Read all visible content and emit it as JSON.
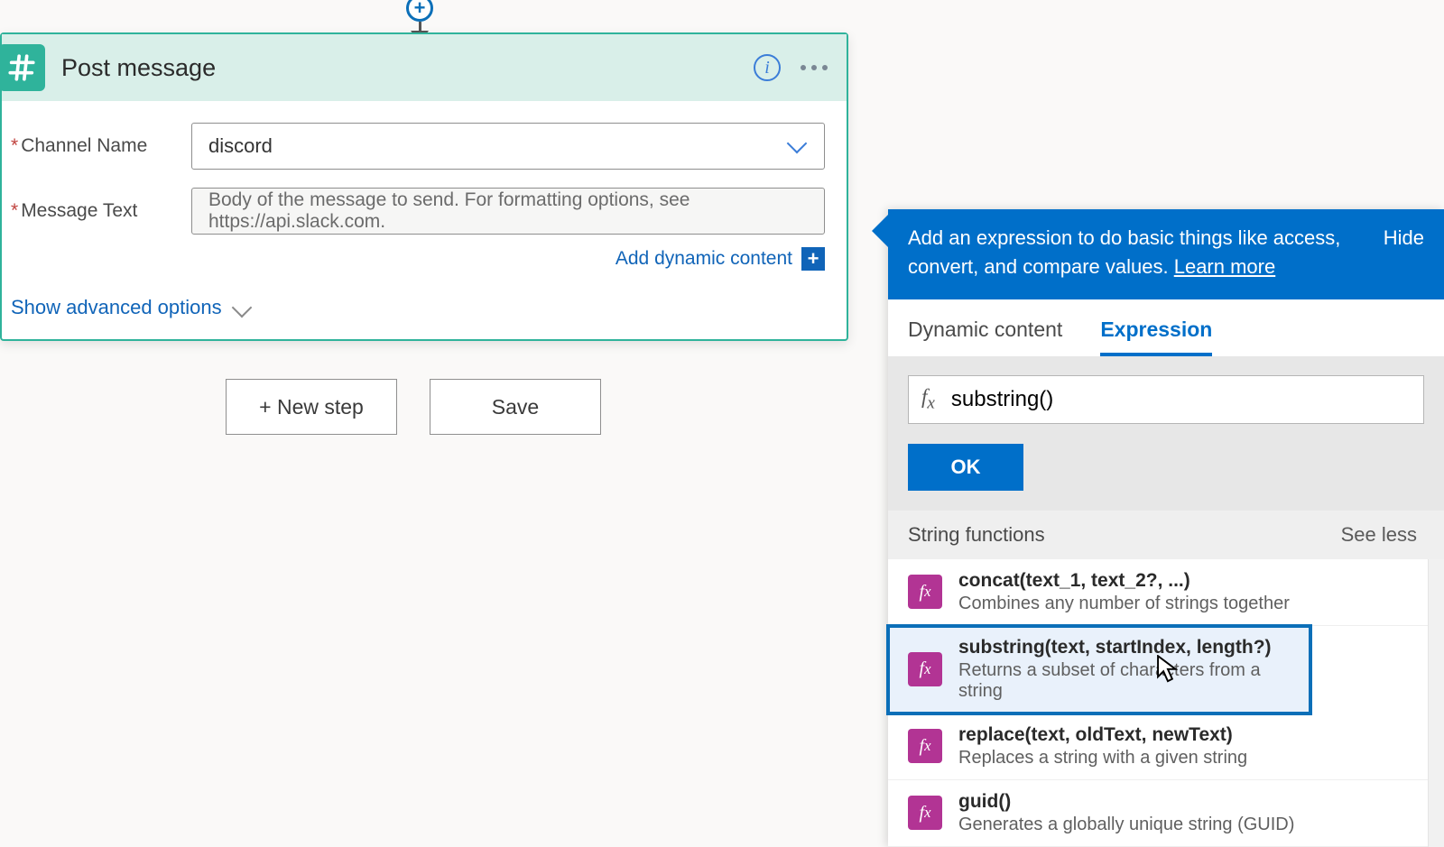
{
  "flow_add_label": "+",
  "card": {
    "title": "Post message",
    "icon": "slack-hash-icon",
    "fields": {
      "channel": {
        "label": "Channel Name",
        "required": true,
        "value": "discord"
      },
      "message": {
        "label": "Message Text",
        "required": true,
        "placeholder": "Body of the message to send. For formatting options, see https://api.slack.com."
      }
    },
    "add_dynamic_label": "Add dynamic content",
    "show_advanced_label": "Show advanced options"
  },
  "buttons": {
    "new_step": "+ New step",
    "save": "Save"
  },
  "panel": {
    "banner_text": "Add an expression to do basic things like access, convert, and compare values. ",
    "learn_more": "Learn more",
    "hide": "Hide",
    "tabs": {
      "dynamic": "Dynamic content",
      "expression": "Expression"
    },
    "expr_value": "substring()",
    "ok": "OK",
    "section_title": "String functions",
    "see_less": "See less",
    "functions": [
      {
        "sig": "concat(text_1, text_2?, ...)",
        "desc": "Combines any number of strings together",
        "selected": false
      },
      {
        "sig": "substring(text, startIndex, length?)",
        "desc": "Returns a subset of characters from a string",
        "selected": true
      },
      {
        "sig": "replace(text, oldText, newText)",
        "desc": "Replaces a string with a given string",
        "selected": false
      },
      {
        "sig": "guid()",
        "desc": "Generates a globally unique string (GUID)",
        "selected": false
      }
    ]
  }
}
